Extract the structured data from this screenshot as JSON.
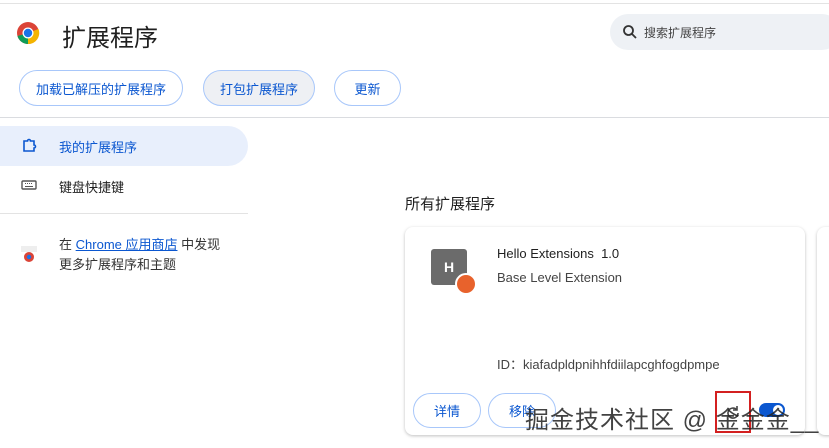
{
  "header": {
    "title": "扩展程序",
    "search_placeholder": "搜索扩展程序"
  },
  "toolbar": {
    "load_unpacked": "加载已解压的扩展程序",
    "pack": "打包扩展程序",
    "update": "更新"
  },
  "sidebar": {
    "items": [
      {
        "label": "我的扩展程序",
        "active": true
      },
      {
        "label": "键盘快捷键"
      }
    ],
    "store_prefix": "在",
    "store_link": "Chrome 应用商店",
    "store_suffix": "中发现",
    "store_line2": "更多扩展程序和主题"
  },
  "main": {
    "section_title": "所有扩展程序",
    "extension": {
      "icon_letter": "H",
      "name": "Hello Extensions",
      "version": "1.0",
      "description": "Base Level Extension",
      "id": "ID：kiafadpldpnihhfdiilapcghfogdpmpe",
      "details": "详情",
      "remove": "移除",
      "enabled": true
    }
  },
  "watermark": "掘金技术社区 @ 金金金__"
}
